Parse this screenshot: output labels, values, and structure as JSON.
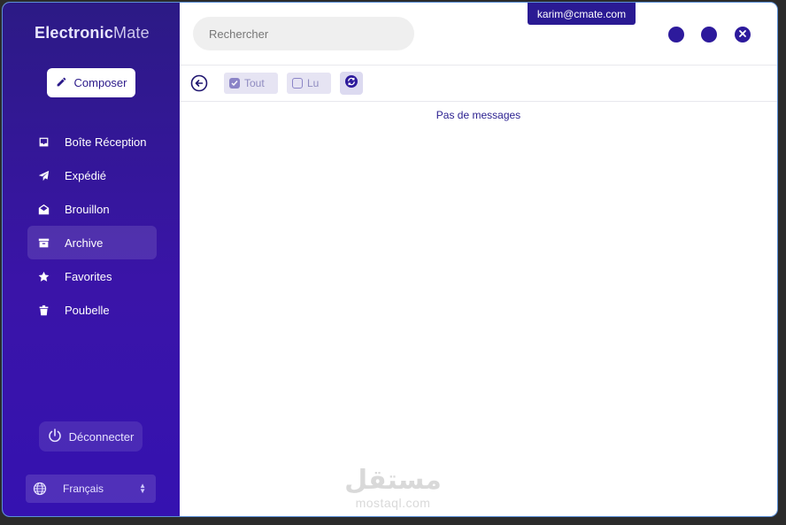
{
  "app": {
    "logo_bold": "Electronic",
    "logo_light": "Mate",
    "user_email": "karim@cmate.com"
  },
  "sidebar": {
    "compose_label": "Composer",
    "items": [
      {
        "label": "Boîte Réception",
        "icon": "inbox-icon"
      },
      {
        "label": "Expédié",
        "icon": "send-icon"
      },
      {
        "label": "Brouillon",
        "icon": "envelope-open-icon"
      },
      {
        "label": "Archive",
        "icon": "archive-icon",
        "active": true
      },
      {
        "label": "Favorites",
        "icon": "star-icon"
      },
      {
        "label": "Poubelle",
        "icon": "trash-icon"
      }
    ],
    "logout_label": "Déconnecter",
    "language": "Français"
  },
  "search": {
    "placeholder": "Rechercher",
    "value": ""
  },
  "toolbar": {
    "filter_all": "Tout",
    "filter_read": "Lu"
  },
  "main": {
    "empty_message": "Pas de messages"
  },
  "watermark": {
    "arabic": "مستقل",
    "latin": "mostaql.com"
  },
  "colors": {
    "accent": "#2d1a9c",
    "sidebar_top": "#2c1a85",
    "sidebar_bottom": "#3512b0"
  }
}
